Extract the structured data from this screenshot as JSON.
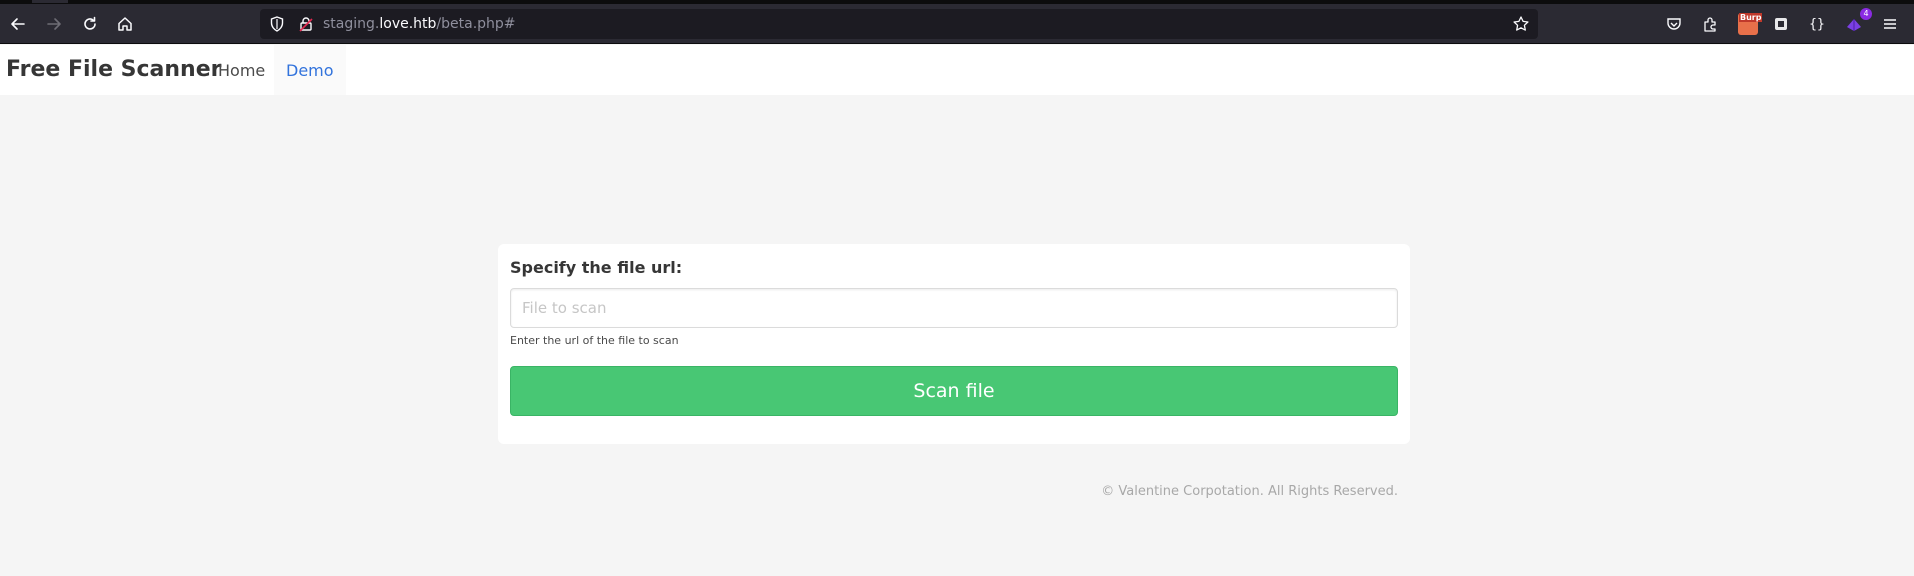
{
  "browser": {
    "url_prefix": "staging.",
    "url_host": "love.htb",
    "url_path": "/beta.php#",
    "burp_label": "Burp",
    "braces_label": "{}",
    "notification_count": "4"
  },
  "site": {
    "brand": "Free File Scanner",
    "nav": {
      "home": "Home",
      "demo": "Demo"
    }
  },
  "form": {
    "label": "Specify the file url:",
    "input_value": "",
    "input_placeholder": "File to scan",
    "help": "Enter the url of the file to scan",
    "button": "Scan file"
  },
  "footer": {
    "text": "© Valentine Corpotation. All Rights Reserved."
  },
  "colors": {
    "browser_toolbar": "#2b2a33",
    "urlbar": "#1c1b22",
    "page_background": "#f5f5f5",
    "active_link": "#3273dc",
    "button_success": "#48c774"
  },
  "icons": [
    "back-icon",
    "forward-icon",
    "reload-icon",
    "home-icon",
    "shield-icon",
    "lock-icon",
    "star-icon",
    "pocket-icon",
    "extensions-icon",
    "burp-icon",
    "container-icon",
    "json-icon",
    "addon-icon",
    "menu-icon"
  ]
}
